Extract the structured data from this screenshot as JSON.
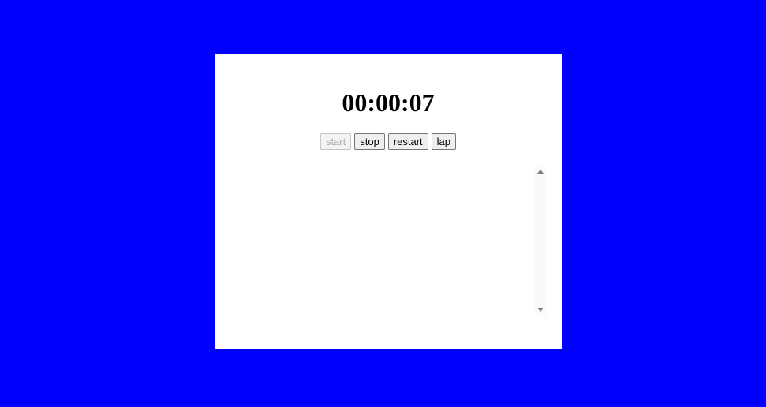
{
  "timer": {
    "display": "00:00:07"
  },
  "controls": {
    "start_label": "start",
    "stop_label": "stop",
    "restart_label": "restart",
    "lap_label": "lap"
  },
  "laps": [],
  "colors": {
    "background": "#0000ff",
    "panel": "#ffffff"
  }
}
